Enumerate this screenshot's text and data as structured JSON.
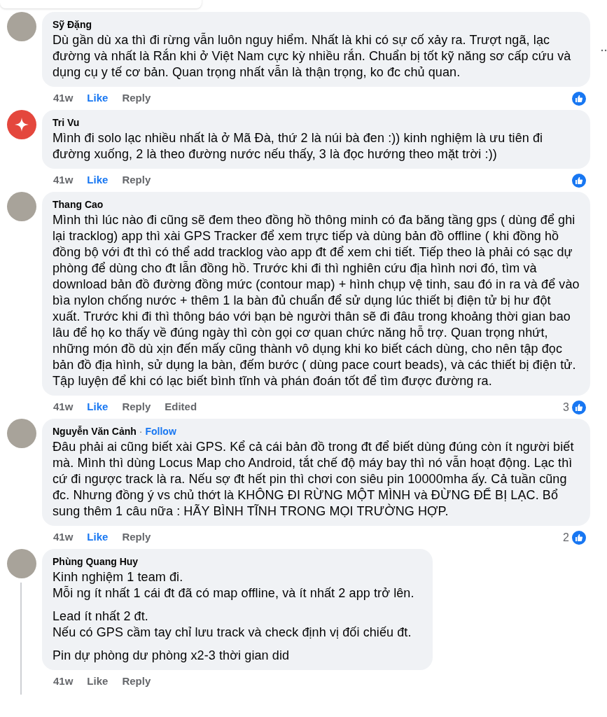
{
  "comments": [
    {
      "author": "Sỹ Đặng",
      "avatar": {
        "kind": "photo"
      },
      "paragraphs": [
        "Dù gần dù xa thì đi rừng vẫn luôn nguy hiểm. Nhất là khi có sự cố xảy ra. Trượt ngã, lạc đường và nhất là Rắn khi ở Việt Nam cực kỳ nhiều rắn. Chuẩn bị tốt kỹ năng sơ cấp cứu và dụng cụ y tế cơ bản. Quan trọng nhất vẫn là thận trọng, ko đc chủ quan."
      ],
      "time": "41w",
      "like": "Like",
      "liked": true,
      "reply": "Reply",
      "reacted": true,
      "thread": false
    },
    {
      "author": "Tri Vu",
      "avatar": {
        "kind": "icon"
      },
      "paragraphs": [
        "Mình đi solo lạc nhiều nhất là ở Mã Đà, thứ 2 là núi bà đen :)) kinh nghiệm là ưu tiên đi đường xuống, 2 là theo đường nước nếu thấy, 3 là đọc hướng theo mặt trời :))"
      ],
      "time": "41w",
      "like": "Like",
      "liked": true,
      "reply": "Reply",
      "reacted": true,
      "thread": false
    },
    {
      "author": "Thang Cao",
      "avatar": {
        "kind": "photo"
      },
      "paragraphs": [
        "Mình thì lúc nào đi cũng sẽ đem theo đồng hồ thông minh có đa băng tầng gps ( dùng để ghi lại tracklog) app thì xài GPS Tracker để xem trực tiếp và dùng bản đồ offline ( khi đồng hồ đồng bộ với đt thì có thể add tracklog vào app đt để xem chi tiết. Tiếp theo là phải có sạc dự phòng để dùng cho đt lẫn đồng hồ. Trước khi đi thì nghiên cứu địa hình nơi đó, tìm và download bản đồ đường đồng mức (contour map) + hình chụp vệ tinh, sau đó in ra và để vào bìa nylon chống nước + thêm 1 la bàn đủ chuẩn để sử dụng lúc thiết bị điện tử bị hư đột xuất. Trước khi đi thì thông báo với bạn bè người thân sẽ đi đâu trong khoảng thời gian bao lâu để họ ko thấy về đúng ngày thì còn gọi cơ quan chức năng hỗ trợ. Quan trọng nhứt, những món đồ dù xịn đến mấy cũng thành vô dụng khi ko biết cách dùng, cho nên tập đọc bản đồ địa hình, sử dụng la bàn, đếm bước ( dùng pace court beads), và các thiết bị điện tử. Tập luyện để khi có lạc biết bình tĩnh và phán đoán tốt để tìm được đường ra."
      ],
      "time": "41w",
      "like": "Like",
      "liked": true,
      "reply": "Reply",
      "edited": "Edited",
      "reaction_count": "3",
      "reacted": true,
      "thread": false
    },
    {
      "author": "Nguyễn Văn Cảnh",
      "avatar": {
        "kind": "photo"
      },
      "separator": "·",
      "follow": "Follow",
      "paragraphs": [
        "Đâu phải ai cũng biết xài GPS. Kể cả cái bản đồ trong đt để biết dùng đúng còn ít người biết mà. Mình thì dùng Locus Map cho Android, tắt chế độ máy bay thì nó vẫn hoạt động. Lạc thì cứ đi ngược track là ra. Nếu sợ đt hết pin thì chơi con siêu pin 10000mha ấy. Cả tuần cũng đc. Nhưng đồng ý vs chủ thớt là KHÔNG ĐI RỪNG MỘT MÌNH và ĐỪNG ĐỂ BỊ LẠC. Bổ sung thêm 1 câu nữa : HÃY BÌNH TĨNH TRONG MỌI TRƯỜNG HỢP."
      ],
      "time": "41w",
      "like": "Like",
      "liked": true,
      "reply": "Reply",
      "reaction_count": "2",
      "reacted": true,
      "thread": false
    },
    {
      "author": "Phùng Quang Huy",
      "avatar": {
        "kind": "photo"
      },
      "paragraphs": [
        "Kinh nghiệm 1 team đi.\nMỗi ng ít nhất 1 cái đt đã có map offline, và ít nhất 2 app trở lên.",
        "Lead ít nhất 2 đt.\nNếu có GPS cầm tay chỉ lưu track và check định vị đối chiếu đt.",
        "Pin dự phòng dư phòng x2-3 thời gian did"
      ],
      "time": "41w",
      "like": "Like",
      "liked": false,
      "reply": "Reply",
      "reacted": false,
      "thread": true
    }
  ]
}
